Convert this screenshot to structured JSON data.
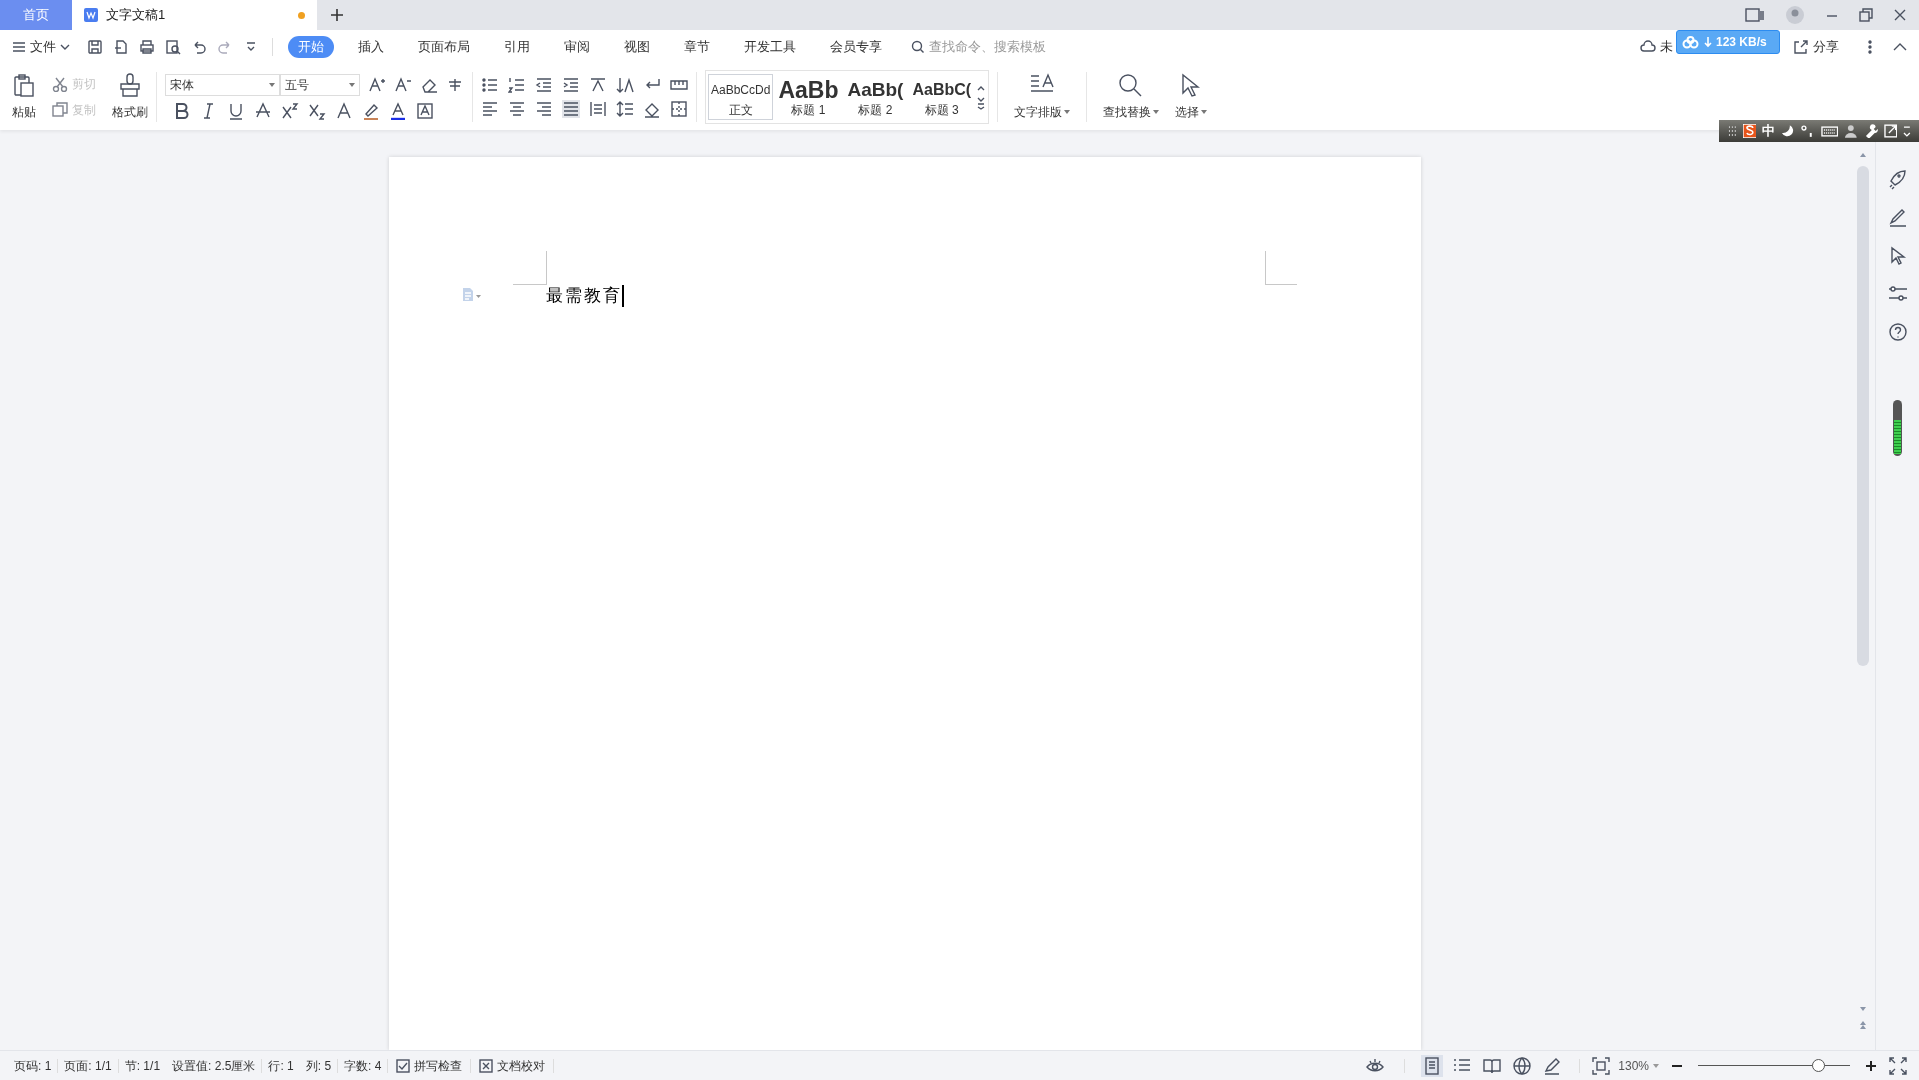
{
  "tabs": [
    {
      "label": "首页",
      "kind": "home",
      "selected": false
    },
    {
      "label": "文字文稿1",
      "kind": "doc",
      "selected": true,
      "unsaved": true
    }
  ],
  "menu": {
    "file": "文件",
    "ribbon_tabs": [
      {
        "label": "开始",
        "selected": true
      },
      {
        "label": "插入",
        "selected": false
      },
      {
        "label": "页面布局",
        "selected": false
      },
      {
        "label": "引用",
        "selected": false
      },
      {
        "label": "审阅",
        "selected": false
      },
      {
        "label": "视图",
        "selected": false
      },
      {
        "label": "章节",
        "selected": false
      },
      {
        "label": "开发工具",
        "selected": false
      },
      {
        "label": "会员专享",
        "selected": false
      }
    ],
    "search": {
      "placeholder": "查找命令、搜索模板"
    },
    "sync": "未",
    "share": "分享"
  },
  "download_widget": {
    "speed": "123 KB/s"
  },
  "ime_bar": {
    "mode": "中"
  },
  "clipboard": {
    "paste": "粘贴",
    "cut": {
      "label": "剪切",
      "disabled": true
    },
    "copy": {
      "label": "复制",
      "disabled": true
    },
    "format_painter": "格式刷"
  },
  "font": {
    "family": "宋体",
    "size": "五号"
  },
  "styles": [
    {
      "preview": "AaBbCcDd",
      "label": "正文",
      "selected": true
    },
    {
      "preview": "AaBb",
      "label": "标题 1",
      "selected": false
    },
    {
      "preview": "AaBb(",
      "label": "标题 2",
      "selected": false
    },
    {
      "preview": "AaBbC(",
      "label": "标题 3",
      "selected": false
    }
  ],
  "big_buttons": [
    {
      "kind": "layout",
      "label": "文字排版"
    },
    {
      "kind": "find",
      "label": "查找替换"
    },
    {
      "kind": "select",
      "label": "选择"
    }
  ],
  "document": {
    "text": "最需教育"
  },
  "status_bar": {
    "items": [
      "页码: 1",
      "页面: 1/1",
      "节: 1/1",
      "设置值: 2.5厘米",
      "行: 1",
      "列: 5",
      "字数: 4"
    ],
    "spell_check": "拼写检查",
    "proofread": "文档校对",
    "zoom": "130%",
    "zoom_level": {
      "level": 0.8
    }
  }
}
